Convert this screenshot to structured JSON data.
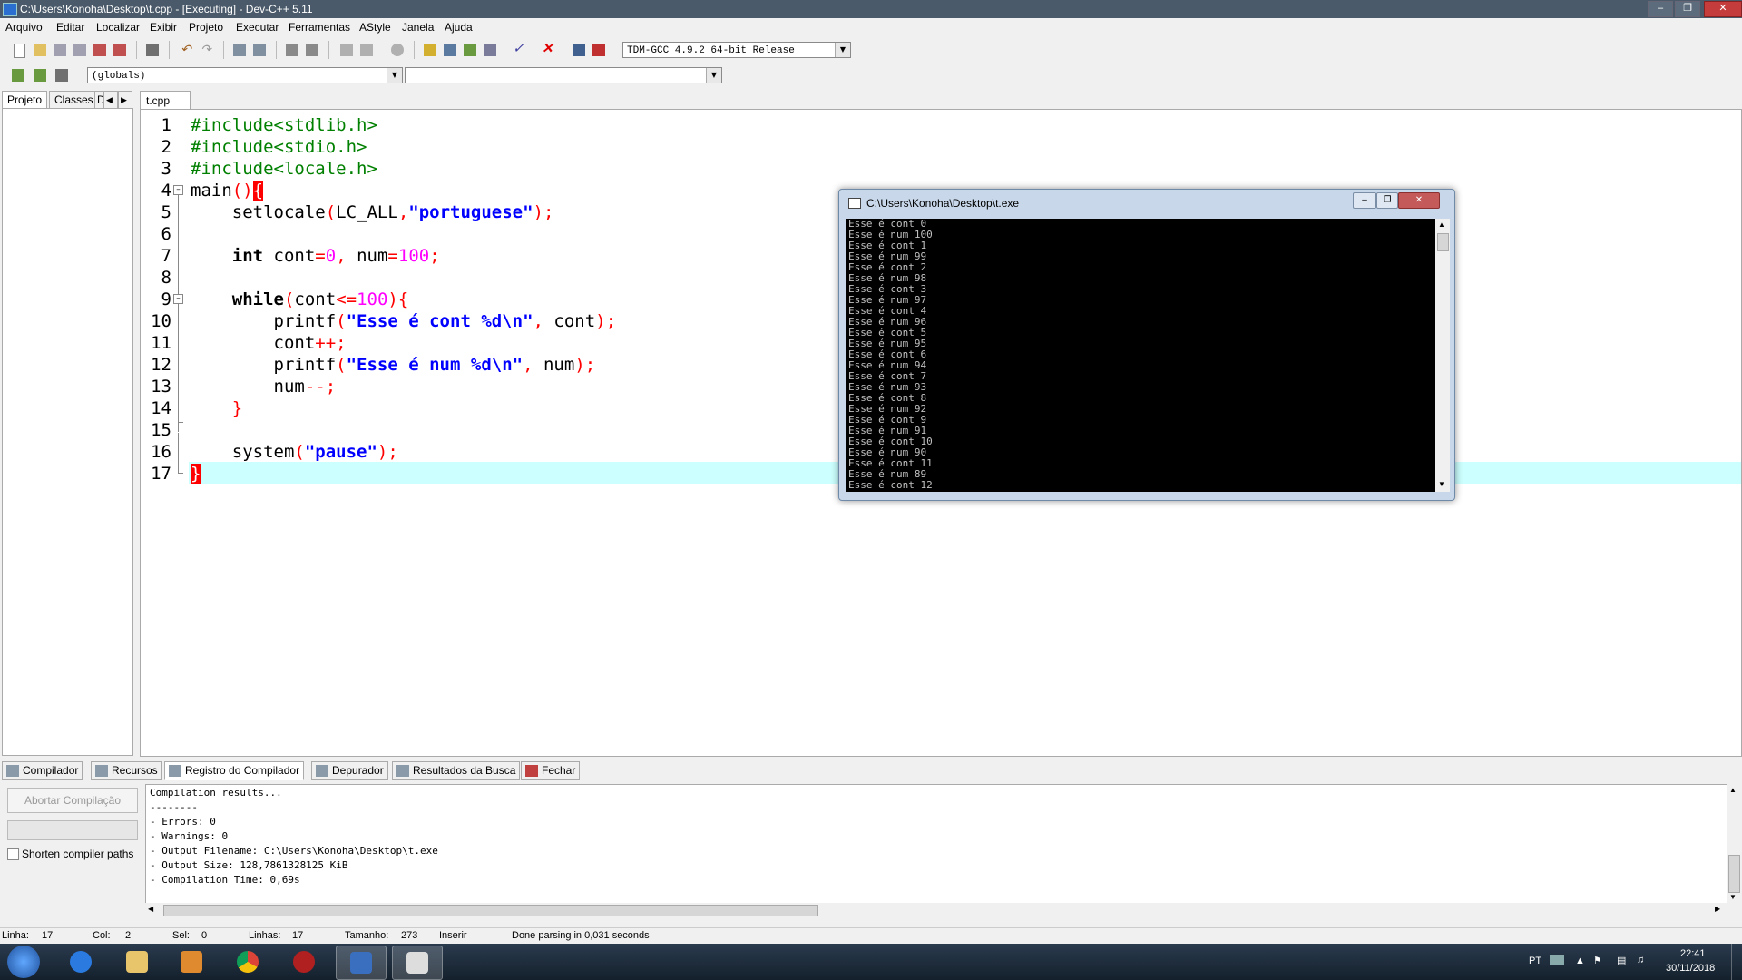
{
  "window": {
    "title": "C:\\Users\\Konoha\\Desktop\\t.cpp - [Executing] - Dev-C++ 5.11"
  },
  "menu": [
    "Arquivo",
    "Editar",
    "Localizar",
    "Exibir",
    "Projeto",
    "Executar",
    "Ferramentas",
    "AStyle",
    "Janela",
    "Ajuda"
  ],
  "toolbar": {
    "compiler_select": "TDM-GCC 4.9.2 64-bit Release",
    "scope_select": "(globals)",
    "function_select": ""
  },
  "left_panel": {
    "tabs": [
      "Projeto",
      "Classes",
      "D"
    ]
  },
  "editor": {
    "file_tab": "t.cpp",
    "line_numbers": [
      "1",
      "2",
      "3",
      "4",
      "5",
      "6",
      "7",
      "8",
      "9",
      "10",
      "11",
      "12",
      "13",
      "14",
      "15",
      "16",
      "17"
    ],
    "current_line": 17
  },
  "console": {
    "title": "C:\\Users\\Konoha\\Desktop\\t.exe",
    "lines": [
      "Esse é cont 0",
      "Esse é num 100",
      "Esse é cont 1",
      "Esse é num 99",
      "Esse é cont 2",
      "Esse é num 98",
      "Esse é cont 3",
      "Esse é num 97",
      "Esse é cont 4",
      "Esse é num 96",
      "Esse é cont 5",
      "Esse é num 95",
      "Esse é cont 6",
      "Esse é num 94",
      "Esse é cont 7",
      "Esse é num 93",
      "Esse é cont 8",
      "Esse é num 92",
      "Esse é cont 9",
      "Esse é num 91",
      "Esse é cont 10",
      "Esse é num 90",
      "Esse é cont 11",
      "Esse é num 89",
      "Esse é cont 12"
    ]
  },
  "bottom_tabs": [
    "Compilador",
    "Recursos",
    "Registro do Compilador",
    "Depurador",
    "Resultados da Busca",
    "Fechar"
  ],
  "compiler_panel": {
    "abort_button": "Abortar Compilação",
    "shorten_label": "Shorten compiler paths",
    "log": [
      "Compilation results...",
      "--------",
      "- Errors: 0",
      "- Warnings: 0",
      "- Output Filename: C:\\Users\\Konoha\\Desktop\\t.exe",
      "- Output Size: 128,7861328125 KiB",
      "- Compilation Time: 0,69s"
    ]
  },
  "status_bar": {
    "linha_label": "Linha:",
    "linha_value": "17",
    "col_label": "Col:",
    "col_value": "2",
    "sel_label": "Sel:",
    "sel_value": "0",
    "linhas_label": "Linhas:",
    "linhas_value": "17",
    "tamanho_label": "Tamanho:",
    "tamanho_value": "273",
    "mode": "Inserir",
    "message": "Done parsing in 0,031 seconds"
  },
  "taskbar": {
    "lang": "PT",
    "time": "22:41",
    "date": "30/11/2018",
    "apps": [
      "start-button",
      "internet-explorer",
      "file-explorer",
      "media-player",
      "chrome",
      "unknown-app",
      "dev-cpp",
      "console-app"
    ]
  }
}
